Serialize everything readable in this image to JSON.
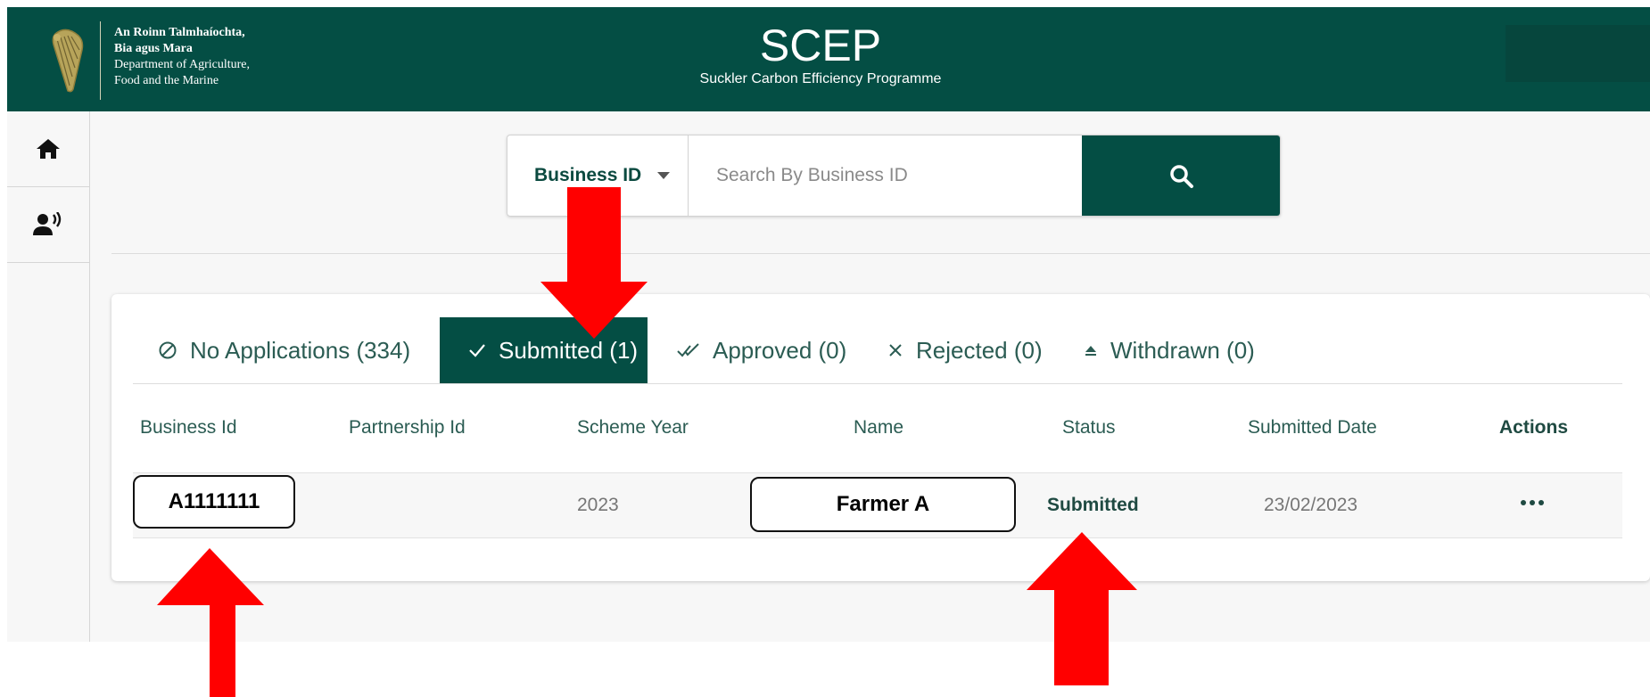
{
  "header": {
    "dept_lines": [
      "An Roinn Talmhaíochta,",
      "Bia agus Mara",
      "Department of Agriculture,",
      "Food and the Marine"
    ],
    "app_title": "SCEP",
    "app_subtitle": "Suckler Carbon Efficiency Programme"
  },
  "sidebar": {
    "items": [
      {
        "icon": "home-icon"
      },
      {
        "icon": "user-speaking-icon"
      }
    ]
  },
  "search": {
    "type_label": "Business ID",
    "placeholder": "Search By Business ID",
    "button_icon": "search-icon"
  },
  "tabs": [
    {
      "label": "No Applications (334)",
      "icon": "no-entry-icon",
      "active": false
    },
    {
      "label": "Submitted (1)",
      "icon": "check-icon",
      "active": true
    },
    {
      "label": "Approved (0)",
      "icon": "double-check-icon",
      "active": false
    },
    {
      "label": "Rejected (0)",
      "icon": "x-icon",
      "active": false
    },
    {
      "label": "Withdrawn (0)",
      "icon": "eject-icon",
      "active": false
    }
  ],
  "table": {
    "columns": [
      "Business Id",
      "Partnership Id",
      "Scheme Year",
      "Name",
      "Status",
      "Submitted Date",
      "Actions"
    ],
    "rows": [
      {
        "business_id": "A1111111",
        "partnership_id": "",
        "scheme_year": "2023",
        "name": "Farmer A",
        "status": "Submitted",
        "submitted_date": "23/02/2023",
        "actions_icon": "more-options-icon"
      }
    ]
  },
  "colors": {
    "brand": "#044e44",
    "annotation_arrow": "#ff0000"
  }
}
